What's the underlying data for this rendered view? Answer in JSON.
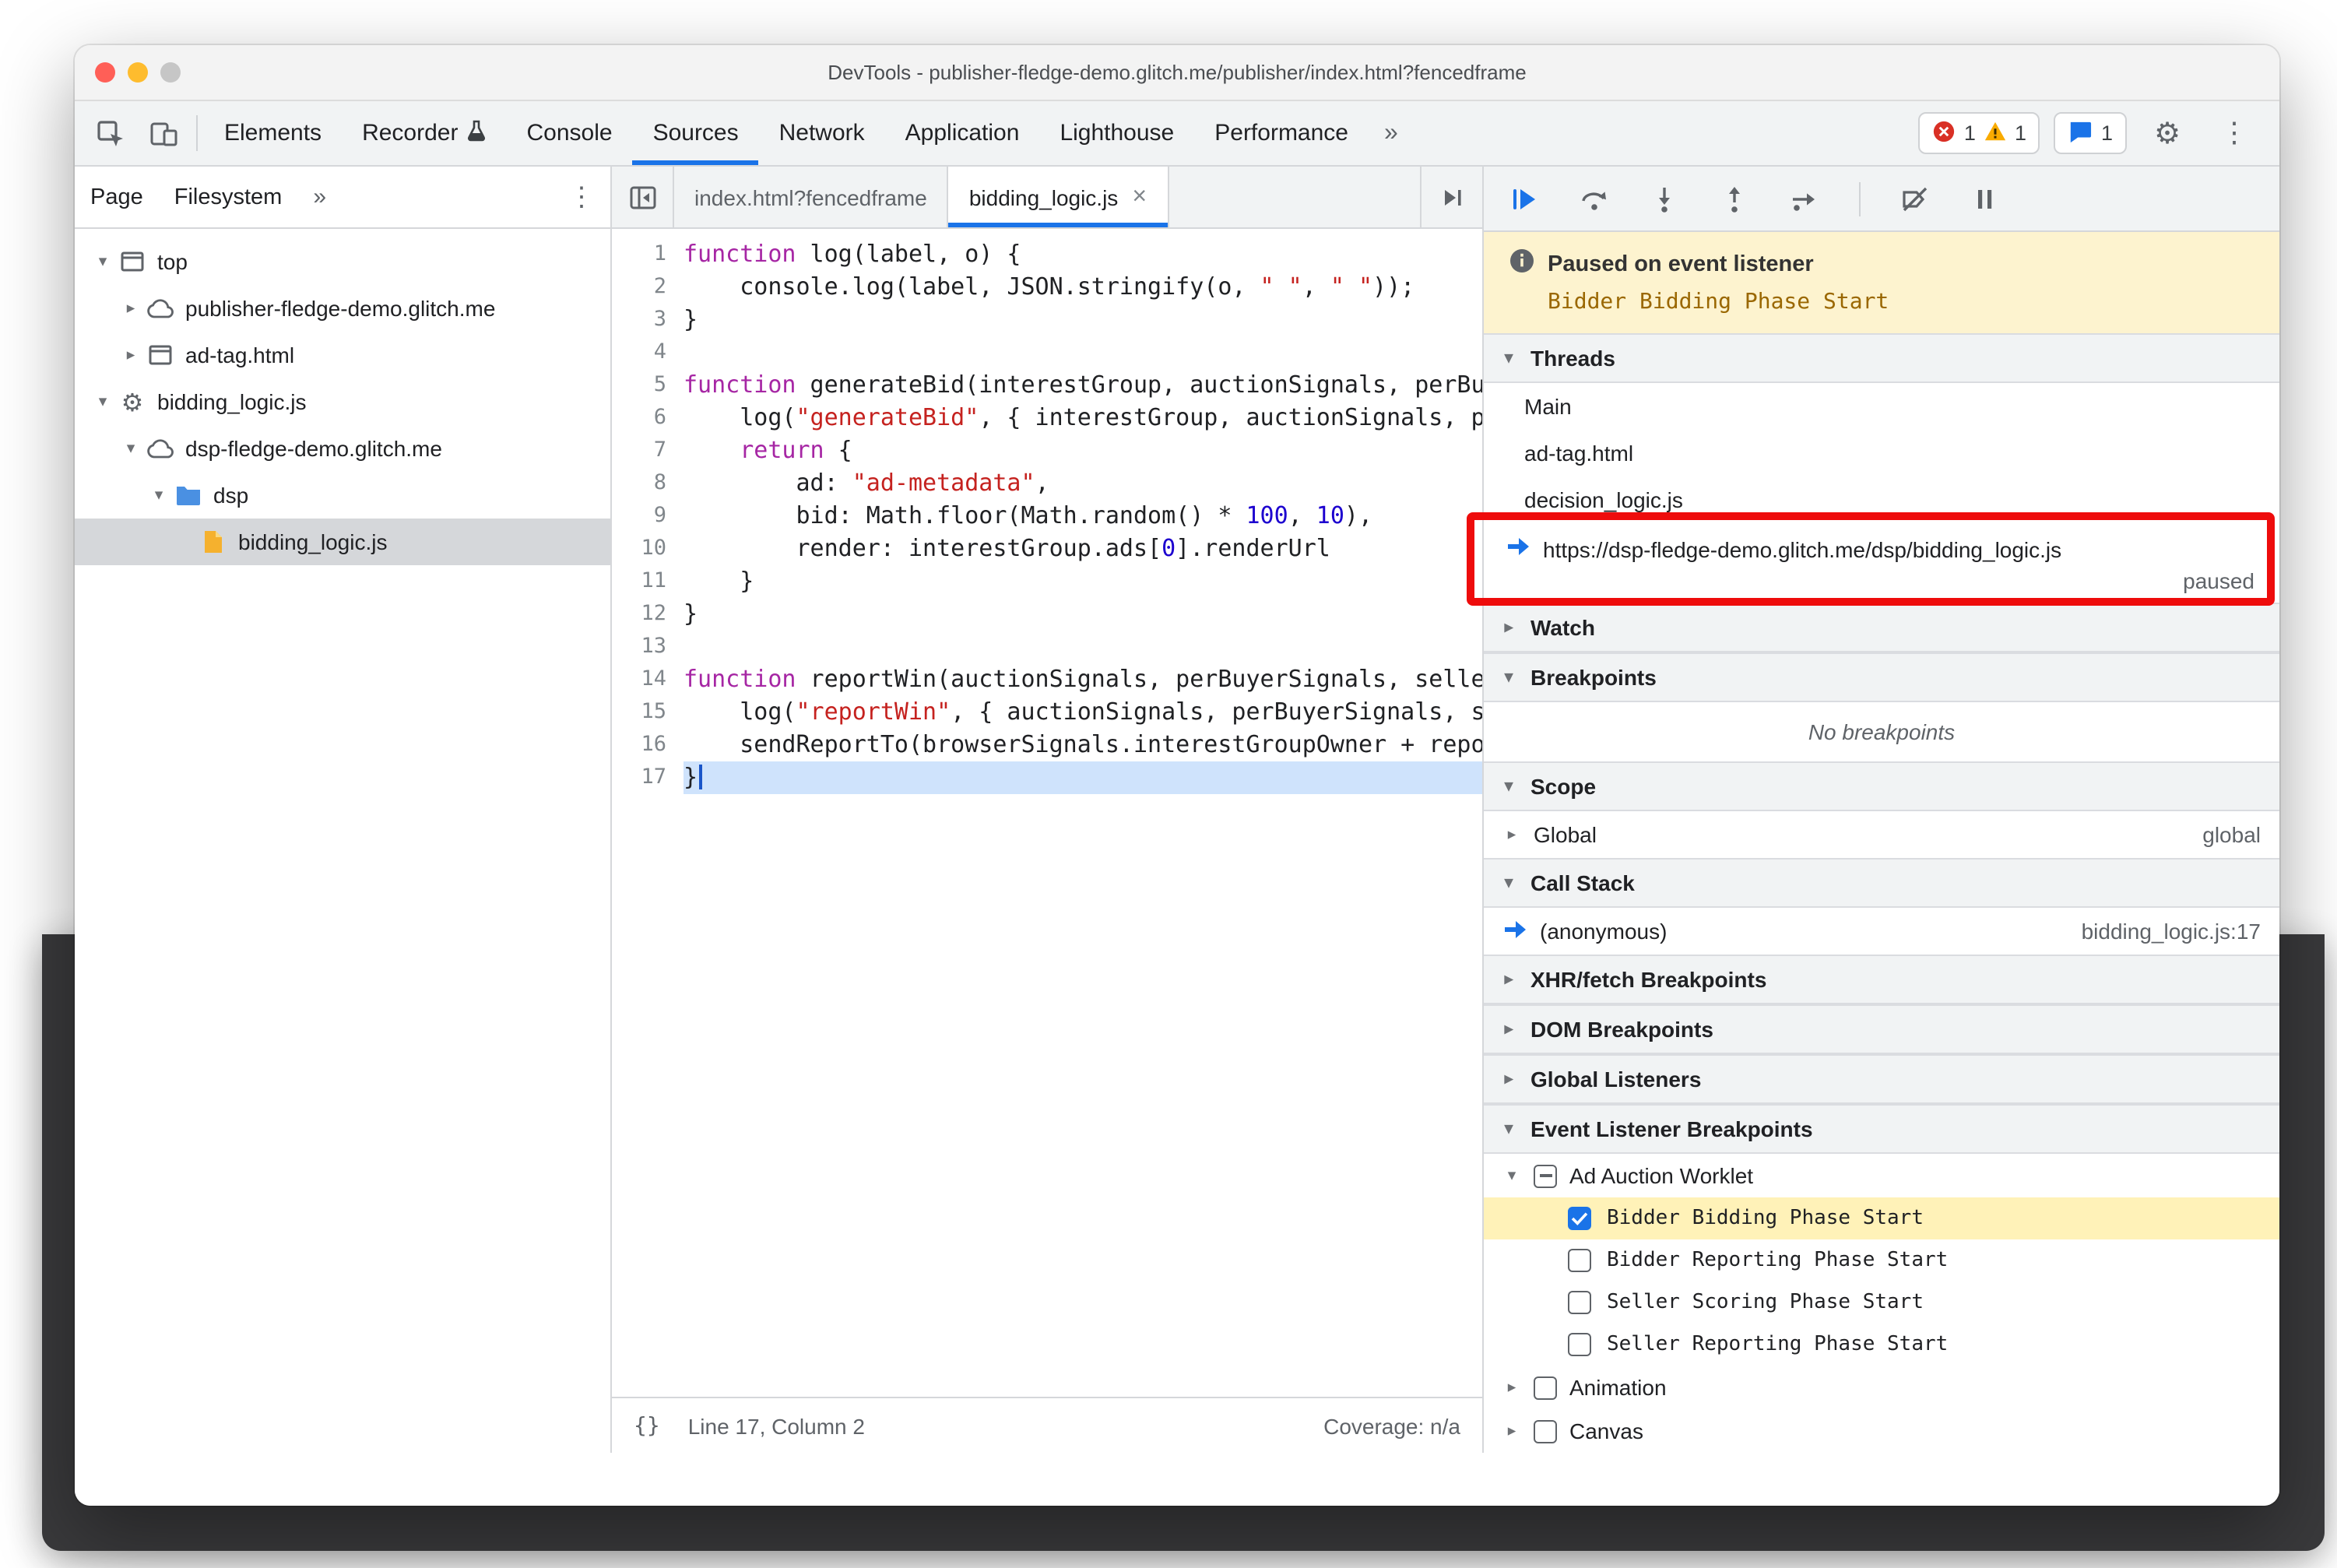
{
  "window": {
    "title": "DevTools - publisher-fledge-demo.glitch.me/publisher/index.html?fencedframe"
  },
  "toolbar": {
    "tabs": [
      "Elements",
      "Recorder",
      "Console",
      "Sources",
      "Network",
      "Application",
      "Lighthouse",
      "Performance"
    ],
    "active_tab": "Sources",
    "more_tabs_glyph": "»",
    "error_count": "1",
    "warning_count": "1",
    "issues_count": "1",
    "kebab_glyph": "⋮",
    "gear_glyph": "⚙"
  },
  "navigator": {
    "tabs": [
      "Page",
      "Filesystem"
    ],
    "active_tab": "Page",
    "more_glyph": "»",
    "kebab_glyph": "⋮",
    "tree": [
      {
        "label": "top"
      },
      {
        "label": "publisher-fledge-demo.glitch.me"
      },
      {
        "label": "ad-tag.html"
      },
      {
        "label": "bidding_logic.js"
      },
      {
        "label": "dsp-fledge-demo.glitch.me"
      },
      {
        "label": "dsp"
      },
      {
        "label": "bidding_logic.js"
      }
    ]
  },
  "editor": {
    "tabs": [
      "index.html?fencedframe",
      "bidding_logic.js"
    ],
    "active_tab": "bidding_logic.js",
    "close_glyph": "×",
    "current_line": 17,
    "status": {
      "pretty_print": "{}",
      "position": "Line 17, Column 2",
      "coverage": "Coverage: n/a"
    },
    "lines": [
      {
        "n": 1,
        "segs": [
          [
            "kw",
            "function"
          ],
          [
            "pl",
            " log(label, o) {"
          ]
        ]
      },
      {
        "n": 2,
        "segs": [
          [
            "pl",
            "    console.log(label, JSON.stringify(o, "
          ],
          [
            "str",
            "\" \""
          ],
          [
            "pl",
            ", "
          ],
          [
            "str",
            "\" \""
          ],
          [
            "pl",
            "));"
          ]
        ]
      },
      {
        "n": 3,
        "segs": [
          [
            "pl",
            "}"
          ]
        ]
      },
      {
        "n": 4,
        "segs": []
      },
      {
        "n": 5,
        "segs": [
          [
            "kw",
            "function"
          ],
          [
            "pl",
            " generateBid(interestGroup, auctionSignals, perBuyerSignals, trustedBiddingSignals, browserSignals) {"
          ]
        ]
      },
      {
        "n": 6,
        "segs": [
          [
            "pl",
            "    log("
          ],
          [
            "str",
            "\"generateBid\""
          ],
          [
            "pl",
            ", { interestGroup, auctionSignals, perBuyerSignals, trustedBiddingSignals });"
          ]
        ]
      },
      {
        "n": 7,
        "segs": [
          [
            "pl",
            "    "
          ],
          [
            "kw",
            "return"
          ],
          [
            "pl",
            " {"
          ]
        ]
      },
      {
        "n": 8,
        "segs": [
          [
            "pl",
            "        ad: "
          ],
          [
            "str",
            "\"ad-metadata\""
          ],
          [
            "pl",
            ","
          ]
        ]
      },
      {
        "n": 9,
        "segs": [
          [
            "pl",
            "        bid: Math.floor(Math.random() * "
          ],
          [
            "num",
            "100"
          ],
          [
            "pl",
            ", "
          ],
          [
            "num",
            "10"
          ],
          [
            "pl",
            "),"
          ]
        ]
      },
      {
        "n": 10,
        "segs": [
          [
            "pl",
            "        render: interestGroup.ads["
          ],
          [
            "num",
            "0"
          ],
          [
            "pl",
            "].renderUrl"
          ]
        ]
      },
      {
        "n": 11,
        "segs": [
          [
            "pl",
            "    }"
          ]
        ]
      },
      {
        "n": 12,
        "segs": [
          [
            "pl",
            "}"
          ]
        ]
      },
      {
        "n": 13,
        "segs": []
      },
      {
        "n": 14,
        "segs": [
          [
            "kw",
            "function"
          ],
          [
            "pl",
            " reportWin(auctionSignals, perBuyerSignals, sellerSignals, browserSignals) {"
          ]
        ]
      },
      {
        "n": 15,
        "segs": [
          [
            "pl",
            "    log("
          ],
          [
            "str",
            "\"reportWin\""
          ],
          [
            "pl",
            ", { auctionSignals, perBuyerSignals, sellerSignals, browserSignals });"
          ]
        ]
      },
      {
        "n": 16,
        "segs": [
          [
            "pl",
            "    sendReportTo(browserSignals.interestGroupOwner + reportUrl);"
          ]
        ]
      },
      {
        "n": 17,
        "segs": [
          [
            "pl",
            "}"
          ]
        ]
      }
    ]
  },
  "debugger": {
    "paused": {
      "title": "Paused on event listener",
      "detail": "Bidder Bidding Phase Start"
    },
    "threads": {
      "title": "Threads",
      "items": [
        "Main",
        "ad-tag.html",
        "decision_logic.js"
      ],
      "active": {
        "url": "https://dsp-fledge-demo.glitch.me/dsp/bidding_logic.js",
        "status": "paused"
      }
    },
    "watch": {
      "title": "Watch"
    },
    "breakpoints": {
      "title": "Breakpoints",
      "empty": "No breakpoints"
    },
    "scope": {
      "title": "Scope",
      "rows": [
        {
          "label": "Global",
          "value": "global"
        }
      ]
    },
    "call_stack": {
      "title": "Call Stack",
      "frames": [
        {
          "label": "(anonymous)",
          "location": "bidding_logic.js:17"
        }
      ]
    },
    "xhr": {
      "title": "XHR/fetch Breakpoints"
    },
    "dom": {
      "title": "DOM Breakpoints"
    },
    "global_listeners": {
      "title": "Global Listeners"
    },
    "event_listener_breakpoints": {
      "title": "Event Listener Breakpoints",
      "groups": [
        {
          "label": "Ad Auction Worklet",
          "checkbox": "indeterminate",
          "items": [
            {
              "label": "Bidder Bidding Phase Start",
              "checked": true
            },
            {
              "label": "Bidder Reporting Phase Start",
              "checked": false
            },
            {
              "label": "Seller Scoring Phase Start",
              "checked": false
            },
            {
              "label": "Seller Reporting Phase Start",
              "checked": false
            }
          ]
        },
        {
          "label": "Animation",
          "checkbox": "unchecked",
          "items": []
        },
        {
          "label": "Canvas",
          "checkbox": "unchecked",
          "items": []
        }
      ]
    }
  },
  "colors": {
    "accent": "#1a73e8",
    "error": "#d93025",
    "warning": "#f9ab00",
    "annotation": "#ee0c0c",
    "paused_banner": "#fdf3cf"
  }
}
